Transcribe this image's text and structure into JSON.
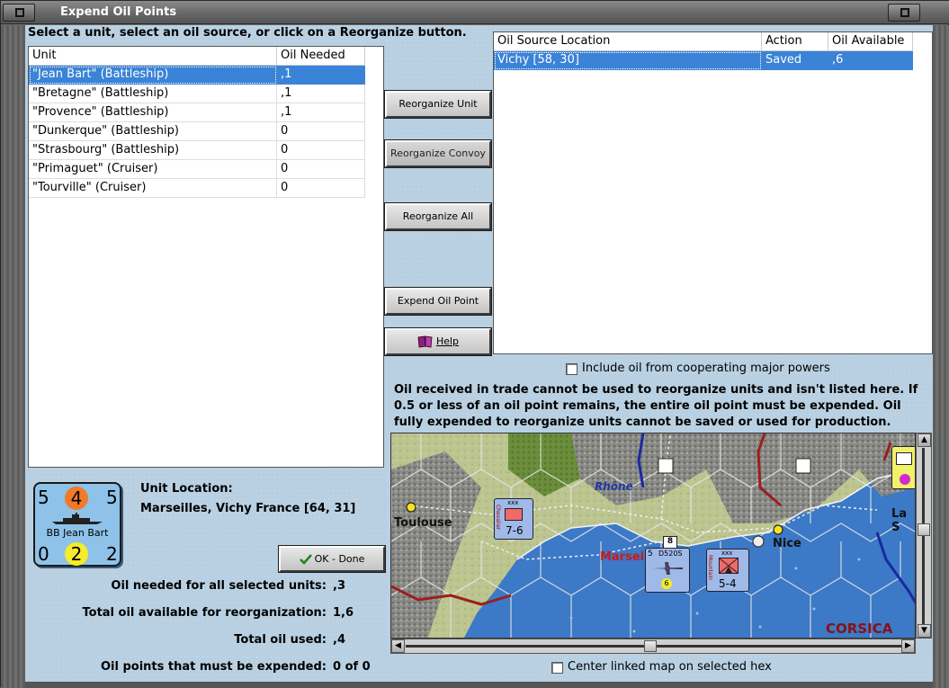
{
  "window": {
    "title": "Expend Oil Points"
  },
  "instruction": "Select a unit, select an oil source, or click on a Reorganize button.",
  "units_table": {
    "headers": [
      "Unit",
      "Oil Needed"
    ],
    "rows": [
      {
        "unit": "\"Jean Bart\" (Battleship)",
        "oil": ",1",
        "selected": true
      },
      {
        "unit": "\"Bretagne\" (Battleship)",
        "oil": ",1",
        "selected": false
      },
      {
        "unit": "\"Provence\" (Battleship)",
        "oil": ",1",
        "selected": false
      },
      {
        "unit": "\"Dunkerque\" (Battleship)",
        "oil": "0",
        "selected": false
      },
      {
        "unit": "\"Strasbourg\" (Battleship)",
        "oil": "0",
        "selected": false
      },
      {
        "unit": "\"Primaguet\" (Cruiser)",
        "oil": "0",
        "selected": false
      },
      {
        "unit": "\"Tourville\" (Cruiser)",
        "oil": "0",
        "selected": false
      }
    ]
  },
  "sources_table": {
    "headers": [
      "Oil Source Location",
      "Action",
      "Oil Available"
    ],
    "rows": [
      {
        "location": "Vichy [58, 30]",
        "action": "Saved",
        "available": ",6",
        "selected": true
      }
    ]
  },
  "buttons": {
    "reorganize_unit": "Reorganize Unit",
    "reorganize_convoy": "Reorganize Convoy",
    "reorganize_all": "Reorganize All",
    "expend_oil_point": "Expend Oil Point",
    "help": "Help",
    "ok_done": "OK - Done"
  },
  "include_oil_label": "Include oil from cooperating major powers",
  "note": "Oil received in trade cannot be used to reorganize units and isn't listed here.  If 0.5 or less of an oil point remains, the entire oil point must be expended.   Oil fully expended to reorganize units cannot be saved or used for production.",
  "unit_location": {
    "label": "Unit Location:",
    "value": "Marseilles, Vichy France [64, 31]"
  },
  "counter": {
    "top_left": "5",
    "top_mid": "4",
    "top_right": "5",
    "name": "BB Jean Bart",
    "bottom_left": "0",
    "bottom_mid": "2",
    "bottom_right": "2"
  },
  "stats": [
    {
      "label": "Oil needed for all selected units:",
      "value": ",3"
    },
    {
      "label": "Total oil available for reorganization:",
      "value": "1,6"
    },
    {
      "label": "Total oil used:",
      "value": ",4"
    },
    {
      "label": "Oil points that must be expended:",
      "value": "0 of 0"
    }
  ],
  "map": {
    "labels": {
      "toulouse": "Toulouse",
      "rhone": "Rhône",
      "marseilles": "Marsei",
      "nice": "Nice",
      "la_s": "La S",
      "corsica": "CORSICA"
    },
    "units": {
      "chevalier": {
        "top": "xxx",
        "bottom": "7-6",
        "side": "Chevalier"
      },
      "fighter": {
        "top": "5",
        "name": "D520S",
        "range": "6"
      },
      "mountain": {
        "top": "xxx",
        "bottom": "5-4",
        "side": "Mountain"
      },
      "stack_count": "8"
    },
    "colors": {
      "sea": "#3c79c6",
      "land": "#b9c48a",
      "border": "#9a1f1f"
    }
  },
  "center_map_label": "Center linked map on selected hex"
}
